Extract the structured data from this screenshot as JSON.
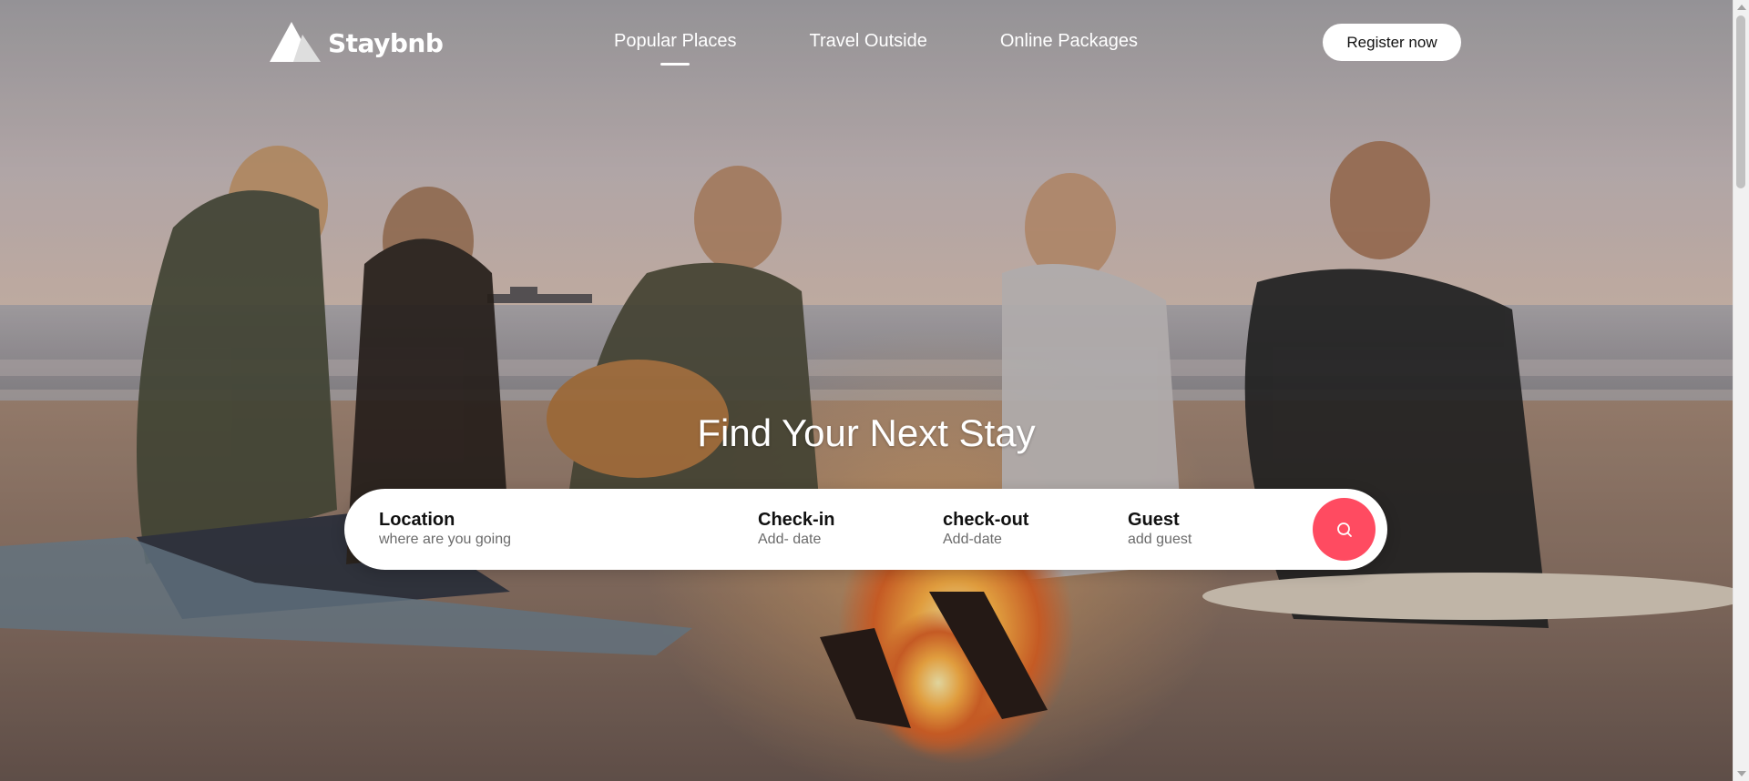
{
  "brand": {
    "name": "Staybnb",
    "logo_icon": "triangle-mountain-logo"
  },
  "nav": {
    "links": [
      {
        "label": "Popular Places",
        "active": true
      },
      {
        "label": "Travel Outside",
        "active": false
      },
      {
        "label": "Online Packages",
        "active": false
      }
    ],
    "register_label": "Register now"
  },
  "hero": {
    "title": "Find Your Next Stay",
    "background": "beach-campfire-sunset-photo"
  },
  "search": {
    "fields": [
      {
        "label": "Location",
        "hint": "where are you going"
      },
      {
        "label": "Check-in",
        "hint": "Add- date"
      },
      {
        "label": "check-out",
        "hint": "Add-date"
      },
      {
        "label": "Guest",
        "hint": "add guest"
      }
    ],
    "button_icon": "search-icon"
  },
  "colors": {
    "accent": "#ff4b61",
    "nav_text": "#ffffff",
    "search_bg": "#ffffff"
  }
}
